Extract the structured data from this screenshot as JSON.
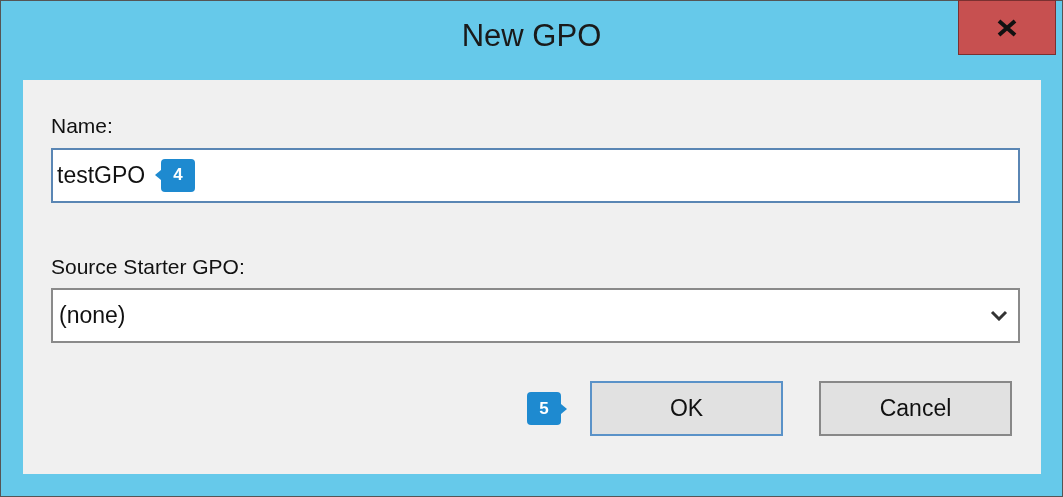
{
  "window": {
    "title": "New GPO"
  },
  "fields": [
    {
      "kind": "text",
      "label": "Name:",
      "value": "testGPO",
      "callout": "4"
    },
    {
      "kind": "dropdown",
      "label": "Source Starter GPO:",
      "value": "(none)"
    }
  ],
  "buttons": [
    {
      "label": "OK",
      "default": true,
      "callout": "5"
    },
    {
      "label": "Cancel",
      "default": false
    }
  ]
}
